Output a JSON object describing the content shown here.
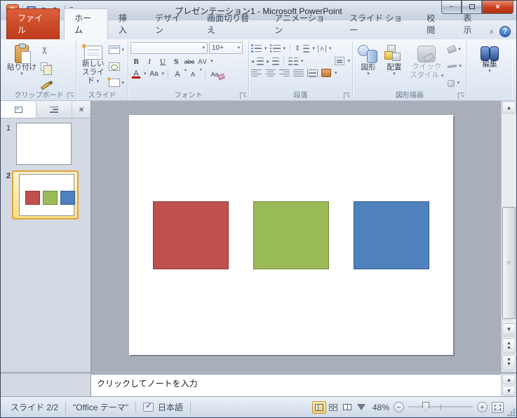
{
  "window": {
    "title": "プレゼンテーション1  -  Microsoft PowerPoint"
  },
  "icons": {
    "app_letter": "P",
    "cut": "✂",
    "undo": "↶",
    "redo": "↻",
    "sparkle": "✷",
    "help": "?",
    "minimize": "–",
    "close_window": "×",
    "chevron_up": "∧",
    "panel_close": "×",
    "scroll_up": "▲",
    "scroll_down": "▼",
    "prev_slide": "▲▲",
    "next_slide": "▼▼"
  },
  "tabs": [
    {
      "label": "ファイル"
    },
    {
      "label": "ホーム"
    },
    {
      "label": "挿入"
    },
    {
      "label": "デザイン"
    },
    {
      "label": "画面切り替え"
    },
    {
      "label": "アニメーション"
    },
    {
      "label": "スライド ショー"
    },
    {
      "label": "校閲"
    },
    {
      "label": "表示"
    }
  ],
  "ribbon": {
    "clipboard": {
      "label": "クリップボード",
      "paste_label": "貼り付け"
    },
    "slides": {
      "label": "スライド",
      "new_slide_line1": "新しい",
      "new_slide_line2": "スライド"
    },
    "font": {
      "label": "フォント",
      "font_name_value": "",
      "size_value": "10+",
      "bold": "B",
      "italic": "I",
      "underline": "U",
      "shadow": "S",
      "strike": "abc",
      "spacing": "AV",
      "color_letter": "A",
      "case_label": "Aa",
      "grow": "A",
      "shrink": "A",
      "clear": "Aa"
    },
    "paragraph": {
      "label": "段落"
    },
    "drawing": {
      "label": "図形描画",
      "shapes_label": "図形",
      "arrange_label": "配置",
      "quick_line1": "クイック",
      "quick_line2": "スタイル"
    },
    "editing": {
      "label": "編集"
    }
  },
  "slide_panel": {
    "slides": [
      {
        "number": "1",
        "selected": false
      },
      {
        "number": "2",
        "selected": true
      }
    ]
  },
  "slide": {
    "shapes": [
      {
        "name": "red-square",
        "color": "#C0504D",
        "border": "#8E3A38"
      },
      {
        "name": "green-square",
        "color": "#9BBB59",
        "border": "#71893F"
      },
      {
        "name": "blue-square",
        "color": "#4F81BD",
        "border": "#385D8A"
      }
    ]
  },
  "notes": {
    "placeholder": "クリックしてノートを入力"
  },
  "status_bar": {
    "slide_indicator": "スライド 2/2",
    "theme": "\"Office テーマ\"",
    "language": "日本語",
    "zoom_percent": "48%"
  },
  "colors": {
    "file_tab": "#C84428",
    "selection_highlight": "#E3A23C",
    "canvas_gray": "#A9AFBA",
    "view_button_highlight": "#F6CE6E"
  }
}
